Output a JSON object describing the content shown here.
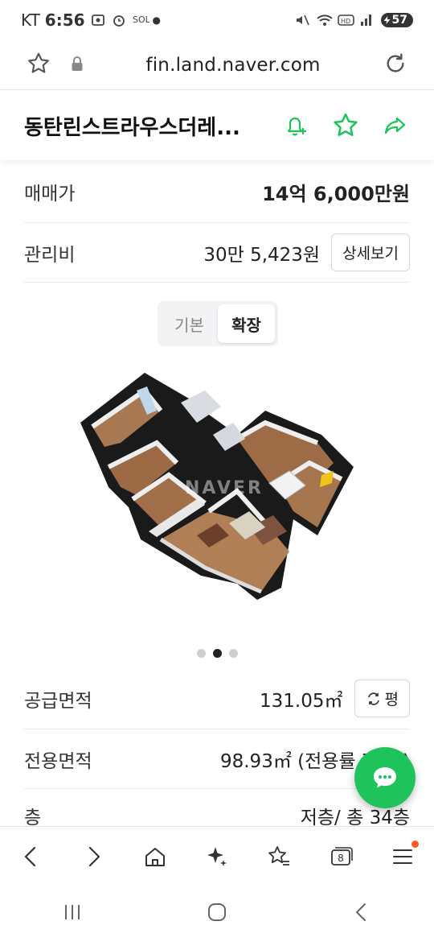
{
  "status_bar": {
    "carrier": "KT",
    "time": "6:56",
    "battery": "57"
  },
  "address_bar": {
    "url": "fin.land.naver.com"
  },
  "header": {
    "title": "동탄린스트라우스더레..."
  },
  "price": {
    "label": "매매가",
    "value": "14억 6,000만원"
  },
  "maintenance": {
    "label": "관리비",
    "value": "30만 5,423원",
    "detail_button": "상세보기"
  },
  "plan_toggle": {
    "options": [
      "기본",
      "확장"
    ],
    "selected": "확장"
  },
  "floorplan": {
    "watermark": "NAVER",
    "carousel_pages": 3,
    "carousel_active": 2
  },
  "supply_area": {
    "label": "공급면적",
    "value": "131.05㎡",
    "unit_button": "평"
  },
  "exclusive_area": {
    "label": "전용면적",
    "value": "98.93㎡ (전용률 75%)"
  },
  "floor": {
    "label": "층",
    "value": "저층/ 총 34층"
  },
  "toolbar": {
    "tab_count": "8"
  },
  "colors": {
    "accent_green": "#1fc35b",
    "badge_orange": "#ff5a1f"
  }
}
